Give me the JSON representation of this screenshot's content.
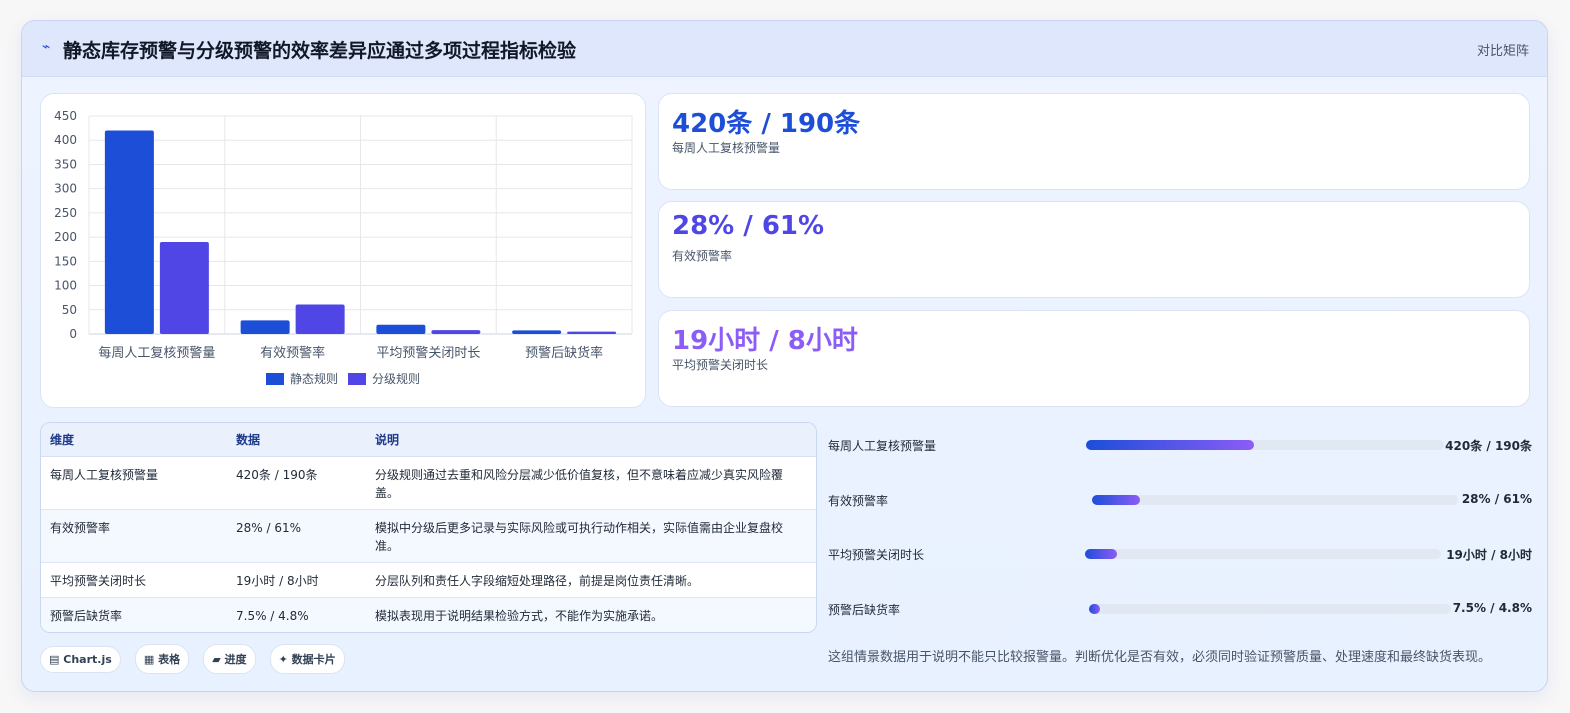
{
  "header": {
    "icon": "zigzag-icon",
    "title": "静态库存预警与分级预警的效率差异应通过多项过程指标检验",
    "right_label": "对比矩阵"
  },
  "chart_data": {
    "type": "bar",
    "categories": [
      "每周人工复核预警量",
      "有效预警率",
      "平均预警关闭时长",
      "预警后缺货率"
    ],
    "series": [
      {
        "name": "静态规则",
        "color": "#1d4ed8",
        "values": [
          420,
          28,
          19,
          7.5
        ]
      },
      {
        "name": "分级规则",
        "color": "#4f46e5",
        "values": [
          190,
          61,
          8,
          4.8
        ]
      }
    ],
    "ylim": [
      0,
      450
    ],
    "yticks": [
      0,
      50,
      100,
      150,
      200,
      250,
      300,
      350,
      400,
      450
    ],
    "grid": true,
    "legend": "bottom"
  },
  "stats": [
    {
      "value": "420条 / 190条",
      "label": "每周人工复核预警量",
      "color": "#1d4ed8"
    },
    {
      "value": "28% / 61%",
      "label": "有效预警率",
      "color": "#4f46e5"
    },
    {
      "value": "19小时 / 8小时",
      "label": "平均预警关闭时长",
      "color": "#8b5cf6"
    }
  ],
  "table": {
    "headers": [
      "维度",
      "数据",
      "说明"
    ],
    "rows": [
      [
        "每周人工复核预警量",
        "420条 / 190条",
        "分级规则通过去重和风险分层减少低价值复核，但不意味着应减少真实风险覆盖。"
      ],
      [
        "有效预警率",
        "28% / 61%",
        "模拟中分级后更多记录与实际风险或可执行动作相关，实际值需由企业复盘校准。"
      ],
      [
        "平均预警关闭时长",
        "19小时 / 8小时",
        "分层队列和责任人字段缩短处理路径，前提是岗位责任清晰。"
      ],
      [
        "预警后缺货率",
        "7.5% / 4.8%",
        "模拟表现用于说明结果检验方式，不能作为实施承诺。"
      ]
    ]
  },
  "pills": [
    {
      "icon": "chart-icon",
      "glyph": "▤",
      "label": "Chart.js"
    },
    {
      "icon": "table-icon",
      "glyph": "▦",
      "label": "表格"
    },
    {
      "icon": "progress-icon",
      "glyph": "▰",
      "label": "进度"
    },
    {
      "icon": "sparkle-icon",
      "glyph": "✦",
      "label": "数据卡片"
    }
  ],
  "progress": [
    {
      "label": "每周人工复核预警量",
      "value": "420条 / 190条",
      "fill": 0.47
    },
    {
      "label": "有效预警率",
      "value": "28% / 61%",
      "fill": 0.13
    },
    {
      "label": "平均预警关闭时长",
      "value": "19小时 / 8小时",
      "fill": 0.09
    },
    {
      "label": "预警后缺货率",
      "value": "7.5% / 4.8%",
      "fill": 0.03
    }
  ],
  "note": "这组情景数据用于说明不能只比较报警量。判断优化是否有效，必须同时验证预警质量、处理速度和最终缺货表现。"
}
